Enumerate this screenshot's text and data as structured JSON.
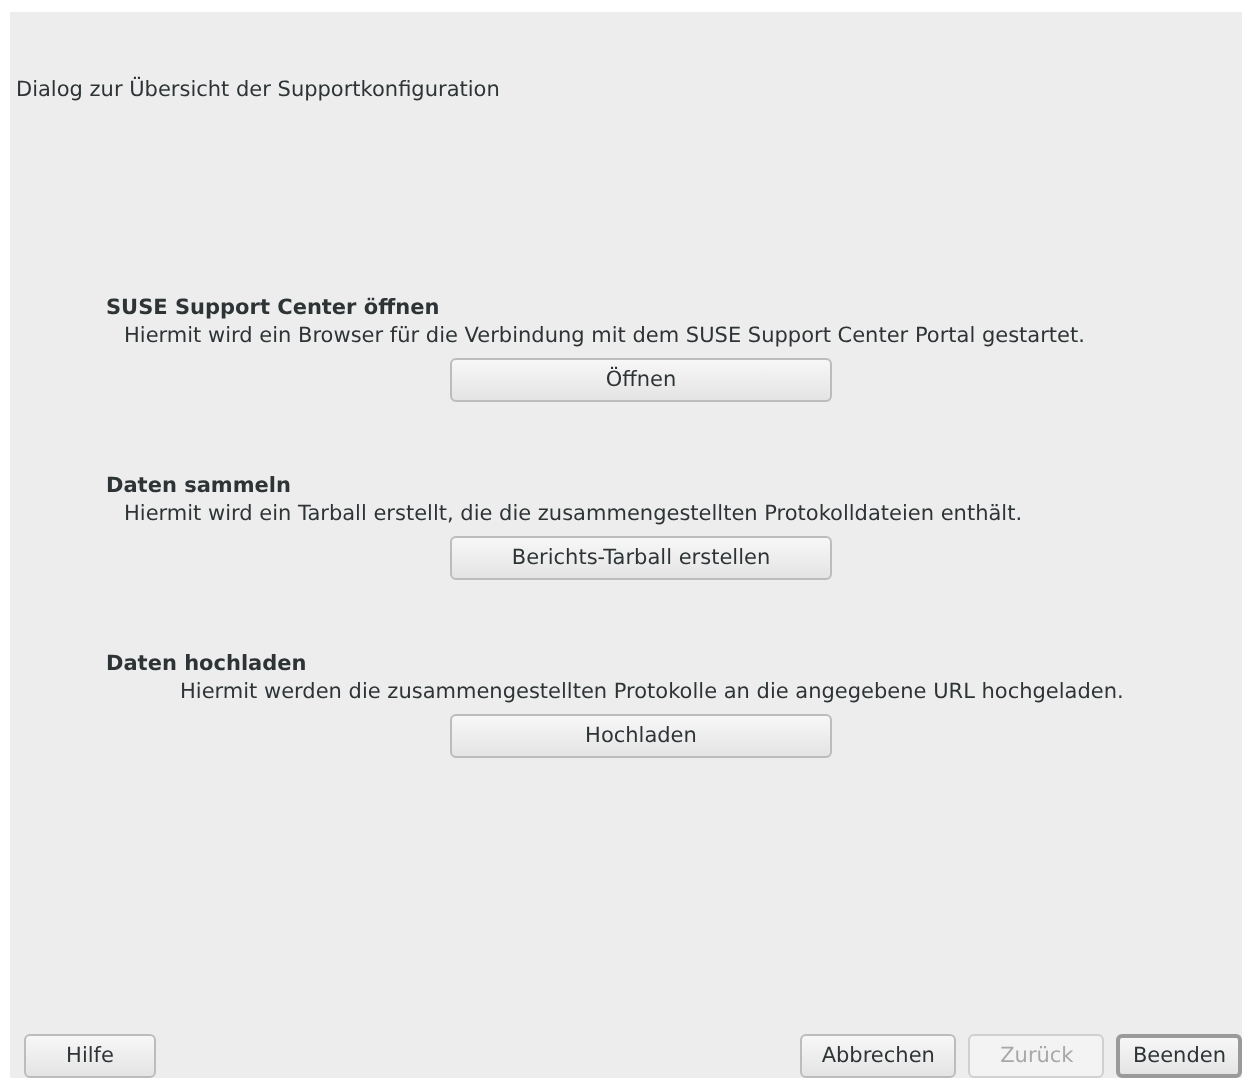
{
  "dialog": {
    "title": "Dialog zur Übersicht der Supportkonfiguration"
  },
  "sections": [
    {
      "heading": "SUSE Support Center öffnen",
      "description": "Hiermit wird ein Browser für die Verbindung mit dem SUSE Support Center Portal gestartet.",
      "button": "Öffnen"
    },
    {
      "heading": "Daten sammeln",
      "description": "Hiermit wird ein Tarball erstellt, die die zusammengestellten Protokolldateien enthält.",
      "button": "Berichts-Tarball erstellen"
    },
    {
      "heading": "Daten hochladen",
      "description": "Hiermit werden die zusammengestellten Protokolle an die angegebene URL hochgeladen.",
      "button": "Hochladen"
    }
  ],
  "footer": {
    "help": {
      "label": "Hilfe",
      "disabled": false
    },
    "actions": [
      {
        "label": "Abbrechen",
        "disabled": false,
        "default": false
      },
      {
        "label": "Zurück",
        "disabled": true,
        "default": false
      },
      {
        "label": "Beenden",
        "disabled": false,
        "default": true
      }
    ]
  }
}
